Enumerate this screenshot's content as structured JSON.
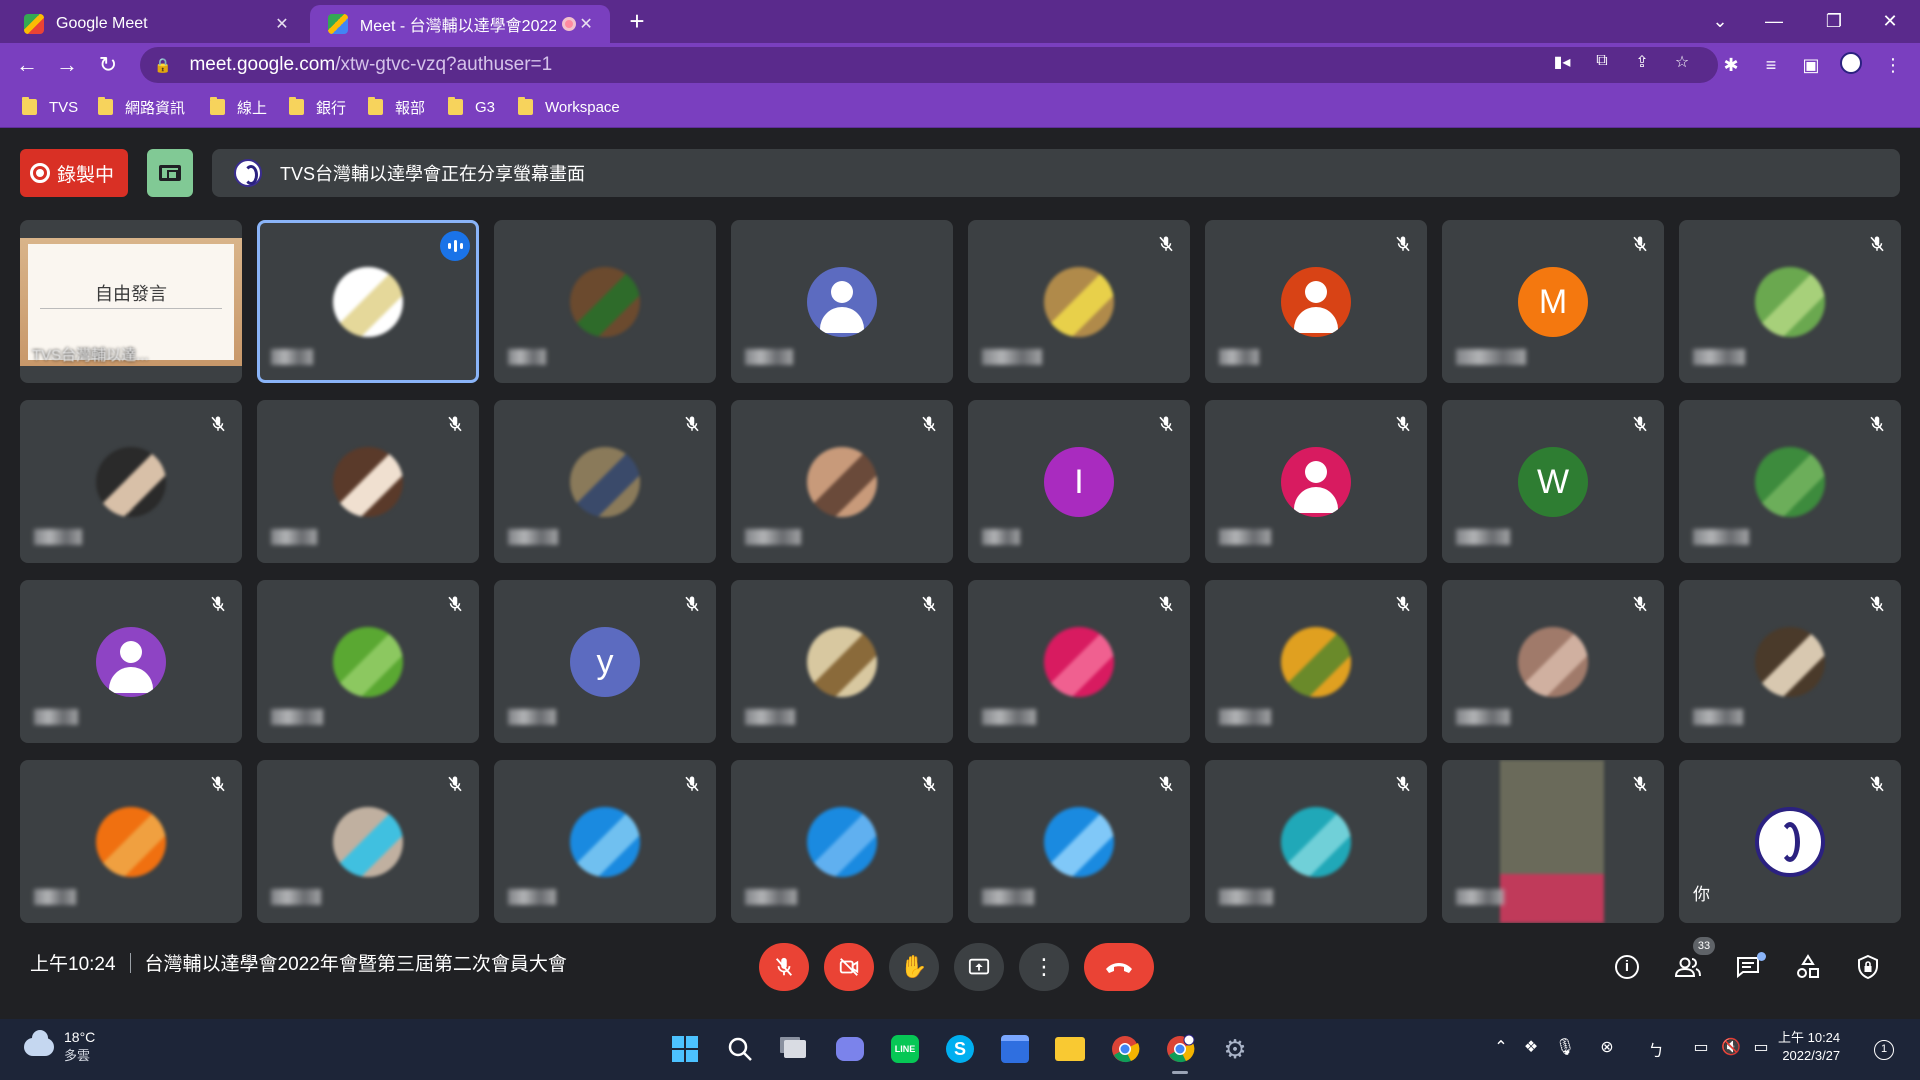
{
  "browser": {
    "tabs": [
      {
        "title": "Google Meet"
      },
      {
        "title": "Meet - 台灣輔以達學會2022"
      }
    ],
    "url_host": "meet.google.com",
    "url_path": "/xtw-gtvc-vzq?authuser=1",
    "bookmarks": [
      "TVS",
      "網路資訊",
      "線上",
      "銀行",
      "報部",
      "G3",
      "Workspace"
    ]
  },
  "meet": {
    "recording_label": "錄製中",
    "share_banner": "TVS台灣輔以達學會正在分享螢幕畫面",
    "presentation": {
      "slide_text": "自由發言",
      "caption": "TVS台灣輔以達..."
    },
    "self_label": "你",
    "time": "上午10:24",
    "meeting_title": "台灣輔以達學會2022年會暨第三屆第二次會員大會",
    "participant_count": "33",
    "tiles": [
      {
        "kind": "photo",
        "colors": [
          "#ffffff",
          "#e5d89a"
        ],
        "muted": false,
        "speaking": true
      },
      {
        "kind": "photo",
        "colors": [
          "#6b4a2e",
          "#2e6b2a"
        ],
        "muted": false
      },
      {
        "kind": "person",
        "color": "#5c6bc0",
        "muted": false
      },
      {
        "kind": "photo",
        "colors": [
          "#b08a4a",
          "#e8d04a"
        ],
        "muted": true
      },
      {
        "kind": "person",
        "color": "#d84315",
        "muted": true
      },
      {
        "kind": "letter",
        "letter": "M",
        "color": "#f4780f",
        "muted": true
      },
      {
        "kind": "photo",
        "colors": [
          "#6aa84f",
          "#a7d07a"
        ],
        "muted": true
      },
      {
        "kind": "photo",
        "colors": [
          "#2a2a2a",
          "#d8c0a8"
        ],
        "muted": true
      },
      {
        "kind": "photo",
        "colors": [
          "#5a3a2a",
          "#f0e0d0"
        ],
        "muted": true
      },
      {
        "kind": "photo",
        "colors": [
          "#8a7a5a",
          "#3a4a6a"
        ],
        "muted": true
      },
      {
        "kind": "photo",
        "colors": [
          "#c89a7a",
          "#6a4a3a"
        ],
        "muted": true
      },
      {
        "kind": "letter",
        "letter": "I",
        "color": "#a92bbf",
        "muted": true
      },
      {
        "kind": "person",
        "color": "#d81b60",
        "muted": true
      },
      {
        "kind": "letter",
        "letter": "W",
        "color": "#2e7d32",
        "muted": true
      },
      {
        "kind": "photo",
        "colors": [
          "#3d8b3d",
          "#6cae5a"
        ],
        "muted": true
      },
      {
        "kind": "person",
        "color": "#8e44c4",
        "muted": true
      },
      {
        "kind": "photo",
        "colors": [
          "#5aa832",
          "#8cc860"
        ],
        "muted": true
      },
      {
        "kind": "letter",
        "letter": "y",
        "color": "#5c6bc0",
        "muted": true
      },
      {
        "kind": "photo",
        "colors": [
          "#d8c8a0",
          "#8a6a3a"
        ],
        "muted": true
      },
      {
        "kind": "photo",
        "colors": [
          "#d81b60",
          "#f06090"
        ],
        "muted": true
      },
      {
        "kind": "photo",
        "colors": [
          "#e0a020",
          "#6a8a2a"
        ],
        "muted": true
      },
      {
        "kind": "photo",
        "colors": [
          "#a07a6a",
          "#d0b0a0"
        ],
        "muted": true
      },
      {
        "kind": "photo",
        "colors": [
          "#4a3a2a",
          "#d8c8b0"
        ],
        "muted": true
      },
      {
        "kind": "photo",
        "colors": [
          "#f07010",
          "#f0a040"
        ],
        "muted": true
      },
      {
        "kind": "photo",
        "colors": [
          "#c0b0a0",
          "#40c0e0"
        ],
        "muted": true
      },
      {
        "kind": "photo",
        "colors": [
          "#1a8ae0",
          "#70c0f0"
        ],
        "muted": true
      },
      {
        "kind": "photo",
        "colors": [
          "#1a8ae0",
          "#60b0f0"
        ],
        "muted": true
      },
      {
        "kind": "photo",
        "colors": [
          "#1a8ae0",
          "#80c8f8"
        ],
        "muted": true
      },
      {
        "kind": "photo",
        "colors": [
          "#20a8b8",
          "#70d0d8"
        ],
        "muted": true
      },
      {
        "kind": "video",
        "colors": [
          "#6a6a5a",
          "#c03a5a"
        ],
        "muted": true
      },
      {
        "kind": "self",
        "muted": true
      }
    ]
  },
  "taskbar": {
    "temperature": "18°C",
    "weather": "多雲",
    "time": "上午 10:24",
    "date": "2022/3/27",
    "notifications": "1"
  }
}
